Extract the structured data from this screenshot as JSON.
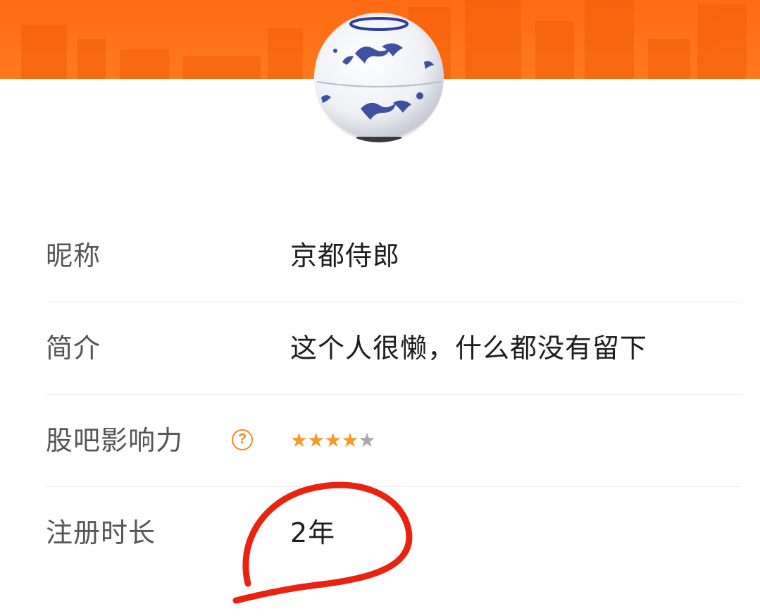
{
  "profile": {
    "avatar_icon": "porcelain-jar-avatar",
    "rows": [
      {
        "label": "昵称",
        "value": "京都侍郎"
      },
      {
        "label": "简介",
        "value": "这个人很懒，什么都没有留下"
      },
      {
        "label": "股吧影响力",
        "help_icon": "question-circle-icon",
        "rating": 4,
        "rating_max": 5
      },
      {
        "label": "注册时长",
        "value": "2年"
      }
    ]
  },
  "colors": {
    "header_orange": "#ff6a12",
    "star_active": "#f39a2b",
    "star_inactive": "#a9a9a9",
    "annotation_red": "#e8230f"
  }
}
